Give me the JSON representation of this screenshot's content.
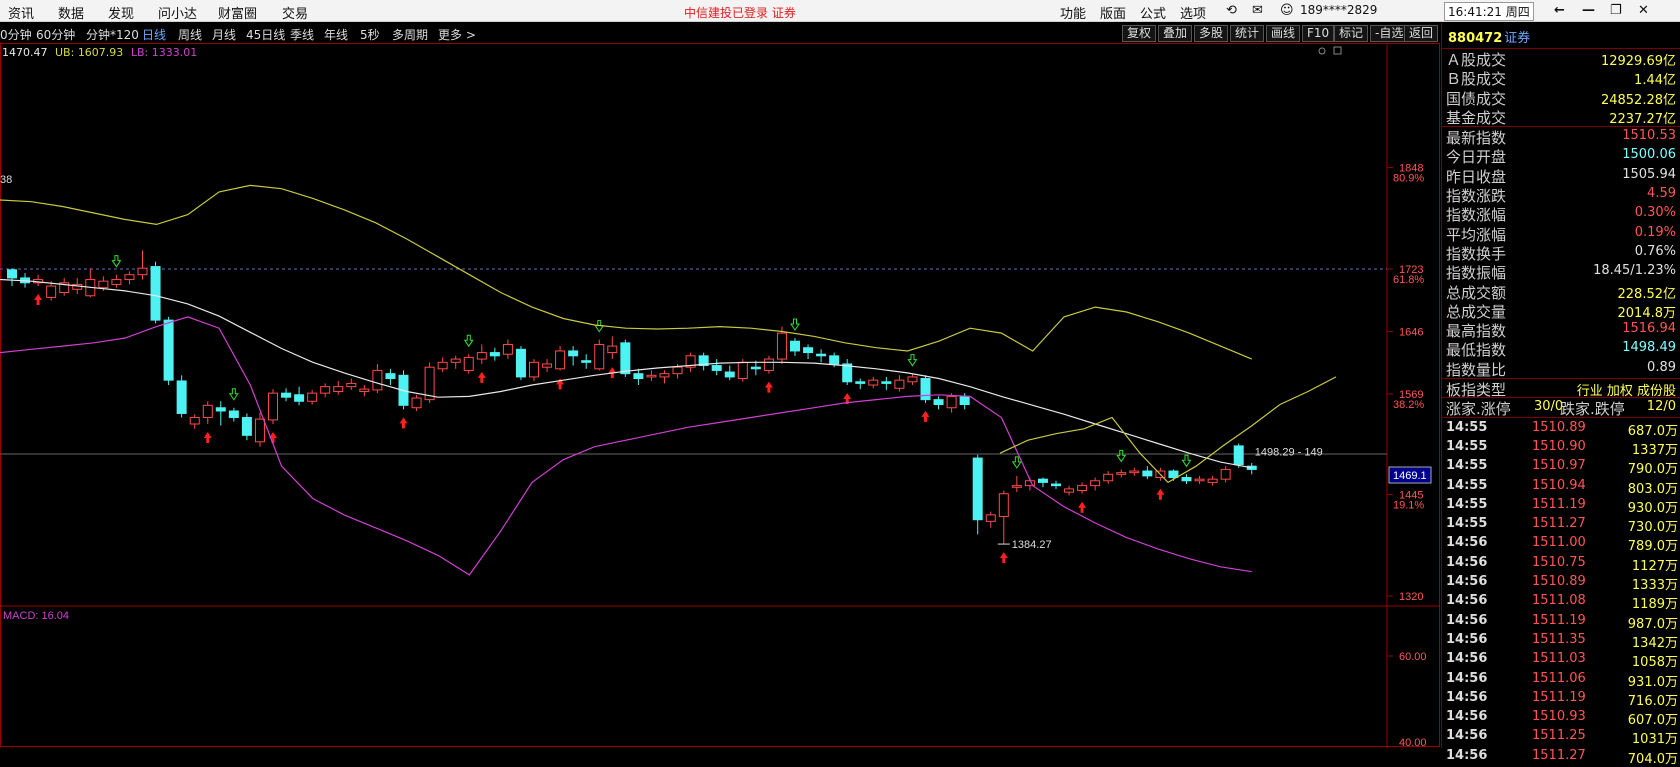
{
  "menu": [
    {
      "label": "资讯",
      "name": "menu-news"
    },
    {
      "label": "数据",
      "name": "menu-data"
    },
    {
      "label": "发现",
      "name": "menu-discover"
    },
    {
      "label": "问小达",
      "name": "menu-ask"
    },
    {
      "label": "财富圈",
      "name": "menu-circle"
    },
    {
      "label": "交易",
      "name": "menu-trade"
    }
  ],
  "broker_status": "中信建投已登录  证券",
  "top_right": {
    "items": [
      "功能",
      "版面",
      "公式",
      "选项"
    ],
    "account": "189****2829",
    "clock": "16:41:21 周四"
  },
  "tabs": [
    "0分钟",
    "60分钟",
    "分钟*120",
    "日线",
    "周线",
    "月线",
    "45日线",
    "季线",
    "年线",
    "5秒",
    "多周期",
    "更多 >"
  ],
  "active_tab": "日线",
  "toolbar": [
    "复权",
    "叠加",
    "多股",
    "统计",
    "画线",
    "F10",
    "标记",
    "-自选",
    "返回"
  ],
  "chart_legend": {
    "mid": "1470.47",
    "ub_label": "UB:",
    "ub": "1607.93",
    "lb_label": "LB:",
    "lb": "1333.01"
  },
  "y_axis_labels": [
    "1848",
    "80.9%",
    "1723",
    "61.8%",
    "1646",
    "1569",
    "38.2%",
    "1445",
    "19.1%",
    "1320"
  ],
  "price_tag": "1469.1",
  "partial_left_label": "38",
  "low_annotation": "1384.27",
  "high_annotation": "1498.29 - 149",
  "macd": {
    "label": "MACD: 16.04",
    "axis": [
      "60.00",
      "40.00"
    ]
  },
  "side": {
    "code": "880472",
    "suffix": "证券",
    "rows1": [
      {
        "l": "Ａ股成交",
        "v": "12929.69亿",
        "c": "#ffff55"
      },
      {
        "l": "Ｂ股成交",
        "v": "1.44亿",
        "c": "#ffff55"
      },
      {
        "l": "国债成交",
        "v": "24852.28亿",
        "c": "#ffff55"
      },
      {
        "l": "基金成交",
        "v": "2237.27亿",
        "c": "#ffff55"
      }
    ],
    "rows2": [
      {
        "l": "最新指数",
        "v": "1510.53",
        "c": "#ff5555"
      },
      {
        "l": "今日开盘",
        "v": "1500.06",
        "c": "#7fffff"
      },
      {
        "l": "昨日收盘",
        "v": "1505.94",
        "c": "#e0e0e0"
      },
      {
        "l": "指数涨跌",
        "v": "4.59",
        "c": "#ff5555"
      },
      {
        "l": "指数涨幅",
        "v": "0.30%",
        "c": "#ff5555"
      },
      {
        "l": "平均涨幅",
        "v": "0.19%",
        "c": "#ff5555"
      },
      {
        "l": "指数换手",
        "v": "0.76%",
        "c": "#e0e0e0"
      },
      {
        "l": "指数振幅",
        "v": "18.45/1.23%",
        "c": "#e0e0e0"
      },
      {
        "l": "总成交额",
        "v": "228.52亿",
        "c": "#ffff55"
      },
      {
        "l": "总成交量",
        "v": "2014.8万",
        "c": "#ffff55"
      },
      {
        "l": "最高指数",
        "v": "1516.94",
        "c": "#ff5555"
      },
      {
        "l": "最低指数",
        "v": "1498.49",
        "c": "#7fffff"
      },
      {
        "l": "指数量比",
        "v": "0.89",
        "c": "#e0e0e0"
      }
    ],
    "category_label": "板指类型",
    "category_value": "行业 加权 成份股",
    "adv_label": "涨家.涨停",
    "adv_value": "30/0",
    "dec_label": "跌家.跌停",
    "dec_value": "12/0",
    "ticks": [
      [
        "14:55",
        "1510.89",
        "687.0万"
      ],
      [
        "14:55",
        "1510.90",
        "1337万"
      ],
      [
        "14:55",
        "1510.97",
        "790.0万"
      ],
      [
        "14:55",
        "1510.94",
        "803.0万"
      ],
      [
        "14:55",
        "1511.19",
        "930.0万"
      ],
      [
        "14:55",
        "1511.27",
        "730.0万"
      ],
      [
        "14:56",
        "1511.00",
        "789.0万"
      ],
      [
        "14:56",
        "1510.75",
        "1127万"
      ],
      [
        "14:56",
        "1510.89",
        "1333万"
      ],
      [
        "14:56",
        "1511.08",
        "1189万"
      ],
      [
        "14:56",
        "1511.19",
        "987.0万"
      ],
      [
        "14:56",
        "1511.35",
        "1342万"
      ],
      [
        "14:56",
        "1511.03",
        "1058万"
      ],
      [
        "14:56",
        "1511.06",
        "931.0万"
      ],
      [
        "14:56",
        "1511.19",
        "716.0万"
      ],
      [
        "14:56",
        "1510.93",
        "607.0万"
      ],
      [
        "14:56",
        "1511.25",
        "1031万"
      ],
      [
        "14:56",
        "1511.27",
        "704.0万"
      ]
    ]
  },
  "colors": {
    "up": "#ff4a4a",
    "down": "#4ef2f2",
    "mid": "#e8e8e8",
    "ub": "#c8c840",
    "lb": "#d040d0",
    "frame": "#9a0000"
  },
  "chart_data": {
    "type": "candlestick",
    "y_axis_ticks": [
      1848,
      1723,
      1646,
      1569,
      1445,
      1320
    ],
    "fib_labels": [
      "80.9%",
      "61.8%",
      "38.2%",
      "19.1%"
    ],
    "last_price": 1469.1,
    "lowest_marked": 1384.27,
    "highest_marked": 1498.29,
    "candles": [
      [
        1722,
        1712,
        1724,
        1702
      ],
      [
        1712,
        1706,
        1718,
        1700
      ],
      [
        1706,
        1710,
        1716,
        1702
      ],
      [
        1688,
        1702,
        1708,
        1684
      ],
      [
        1694,
        1706,
        1712,
        1690
      ],
      [
        1698,
        1704,
        1712,
        1692
      ],
      [
        1690,
        1710,
        1724,
        1688
      ],
      [
        1700,
        1708,
        1714,
        1696
      ],
      [
        1704,
        1710,
        1716,
        1700
      ],
      [
        1710,
        1716,
        1720,
        1704
      ],
      [
        1716,
        1724,
        1746,
        1710
      ],
      [
        1726,
        1660,
        1732,
        1656
      ],
      [
        1660,
        1586,
        1664,
        1580
      ],
      [
        1585,
        1545,
        1592,
        1540
      ],
      [
        1532,
        1540,
        1544,
        1526
      ],
      [
        1540,
        1555,
        1560,
        1532
      ],
      [
        1552,
        1548,
        1560,
        1530
      ],
      [
        1548,
        1540,
        1552,
        1535
      ],
      [
        1540,
        1518,
        1545,
        1512
      ],
      [
        1510,
        1538,
        1546,
        1504
      ],
      [
        1537,
        1570,
        1575,
        1532
      ],
      [
        1570,
        1565,
        1576,
        1560
      ],
      [
        1568,
        1560,
        1578,
        1555
      ],
      [
        1560,
        1570,
        1574,
        1556
      ],
      [
        1570,
        1578,
        1582,
        1565
      ],
      [
        1572,
        1578,
        1585,
        1568
      ],
      [
        1578,
        1582,
        1588,
        1574
      ],
      [
        1572,
        1575,
        1580,
        1566
      ],
      [
        1574,
        1598,
        1606,
        1570
      ],
      [
        1594,
        1588,
        1600,
        1580
      ],
      [
        1592,
        1555,
        1598,
        1550
      ],
      [
        1552,
        1564,
        1568,
        1548
      ],
      [
        1562,
        1602,
        1608,
        1558
      ],
      [
        1600,
        1608,
        1614,
        1596
      ],
      [
        1608,
        1612,
        1616,
        1600
      ],
      [
        1598,
        1614,
        1618,
        1594
      ],
      [
        1612,
        1620,
        1630,
        1606
      ],
      [
        1620,
        1616,
        1626,
        1610
      ],
      [
        1618,
        1630,
        1636,
        1612
      ],
      [
        1624,
        1590,
        1628,
        1586
      ],
      [
        1590,
        1608,
        1612,
        1585
      ],
      [
        1602,
        1606,
        1612,
        1596
      ],
      [
        1600,
        1622,
        1628,
        1598
      ],
      [
        1622,
        1616,
        1628,
        1604
      ],
      [
        1610,
        1608,
        1618,
        1600
      ],
      [
        1600,
        1630,
        1636,
        1598
      ],
      [
        1620,
        1628,
        1640,
        1612
      ],
      [
        1632,
        1594,
        1636,
        1590
      ],
      [
        1594,
        1588,
        1600,
        1580
      ],
      [
        1590,
        1592,
        1598,
        1585
      ],
      [
        1590,
        1594,
        1598,
        1582
      ],
      [
        1594,
        1602,
        1606,
        1588
      ],
      [
        1602,
        1616,
        1620,
        1596
      ],
      [
        1616,
        1604,
        1620,
        1598
      ],
      [
        1604,
        1598,
        1612,
        1592
      ],
      [
        1596,
        1590,
        1604,
        1586
      ],
      [
        1588,
        1608,
        1612,
        1584
      ],
      [
        1602,
        1600,
        1610,
        1592
      ],
      [
        1598,
        1612,
        1616,
        1594
      ],
      [
        1612,
        1644,
        1652,
        1606
      ],
      [
        1634,
        1622,
        1638,
        1616
      ],
      [
        1626,
        1620,
        1630,
        1612
      ],
      [
        1618,
        1616,
        1624,
        1608
      ],
      [
        1616,
        1606,
        1620,
        1602
      ],
      [
        1606,
        1584,
        1612,
        1580
      ],
      [
        1584,
        1582,
        1588,
        1575
      ],
      [
        1580,
        1586,
        1590,
        1576
      ],
      [
        1584,
        1582,
        1590,
        1574
      ],
      [
        1576,
        1586,
        1592,
        1572
      ],
      [
        1584,
        1590,
        1594,
        1580
      ],
      [
        1588,
        1562,
        1592,
        1558
      ],
      [
        1562,
        1556,
        1566,
        1550
      ],
      [
        1552,
        1566,
        1570,
        1546
      ],
      [
        1566,
        1556,
        1570,
        1550
      ],
      [
        1490,
        1414,
        1494,
        1396
      ],
      [
        1412,
        1420,
        1424,
        1404
      ],
      [
        1418,
        1446,
        1450,
        1384
      ],
      [
        1454,
        1456,
        1468,
        1448
      ],
      [
        1456,
        1462,
        1466,
        1450
      ],
      [
        1464,
        1460,
        1466,
        1454
      ],
      [
        1458,
        1456,
        1462,
        1452
      ],
      [
        1448,
        1452,
        1456,
        1444
      ],
      [
        1450,
        1456,
        1460,
        1446
      ],
      [
        1456,
        1462,
        1466,
        1450
      ],
      [
        1462,
        1470,
        1474,
        1458
      ],
      [
        1470,
        1472,
        1476,
        1466
      ],
      [
        1472,
        1474,
        1478,
        1468
      ],
      [
        1474,
        1468,
        1480,
        1464
      ],
      [
        1466,
        1474,
        1478,
        1462
      ],
      [
        1474,
        1466,
        1476,
        1462
      ],
      [
        1466,
        1462,
        1470,
        1458
      ],
      [
        1462,
        1464,
        1468,
        1458
      ],
      [
        1460,
        1464,
        1468,
        1456
      ],
      [
        1464,
        1476,
        1480,
        1460
      ],
      [
        1505,
        1482,
        1508,
        1478
      ],
      [
        1480,
        1476,
        1484,
        1470
      ]
    ],
    "arrows": {
      "up": [
        2,
        15,
        20,
        30,
        36,
        42,
        46,
        58,
        64,
        70,
        76,
        82,
        88
      ],
      "down": [
        8,
        17,
        35,
        45,
        60,
        69,
        77,
        85,
        90
      ]
    },
    "bands": {
      "mid": [
        1710,
        1708,
        1704,
        1700,
        1696,
        1690,
        1680,
        1665,
        1645,
        1625,
        1608,
        1595,
        1583,
        1572,
        1565,
        1566,
        1572,
        1580,
        1586,
        1592,
        1597,
        1601,
        1604,
        1607,
        1608,
        1608,
        1607,
        1604,
        1600,
        1595,
        1588,
        1578,
        1566,
        1555,
        1544,
        1532,
        1520,
        1508,
        1496,
        1485,
        1478
      ],
      "ub": [
        1808,
        1806,
        1800,
        1792,
        1784,
        1778,
        1790,
        1818,
        1826,
        1822,
        1810,
        1796,
        1780,
        1760,
        1738,
        1716,
        1694,
        1676,
        1662,
        1654,
        1650,
        1649,
        1650,
        1652,
        1650,
        1646,
        1640,
        1632,
        1626,
        1622,
        1634,
        1650,
        1644,
        1622,
        1664,
        1676,
        1670,
        1658,
        1644,
        1628,
        1612
      ],
      "lb": [
        1620,
        1624,
        1628,
        1632,
        1638,
        1652,
        1664,
        1650,
        1580,
        1480,
        1440,
        1420,
        1404,
        1388,
        1370,
        1346,
        1400,
        1460,
        1488,
        1504,
        1512,
        1520,
        1528,
        1534,
        1540,
        1546,
        1552,
        1558,
        1562,
        1566,
        1568,
        1566,
        1540,
        1456,
        1430,
        1410,
        1392,
        1378,
        1366,
        1356,
        1350
      ]
    },
    "ub_right_hook": [
      1496,
      1512,
      1520,
      1526,
      1540,
      1496,
      1460,
      1480,
      1506,
      1530,
      1556,
      1572,
      1590
    ]
  }
}
